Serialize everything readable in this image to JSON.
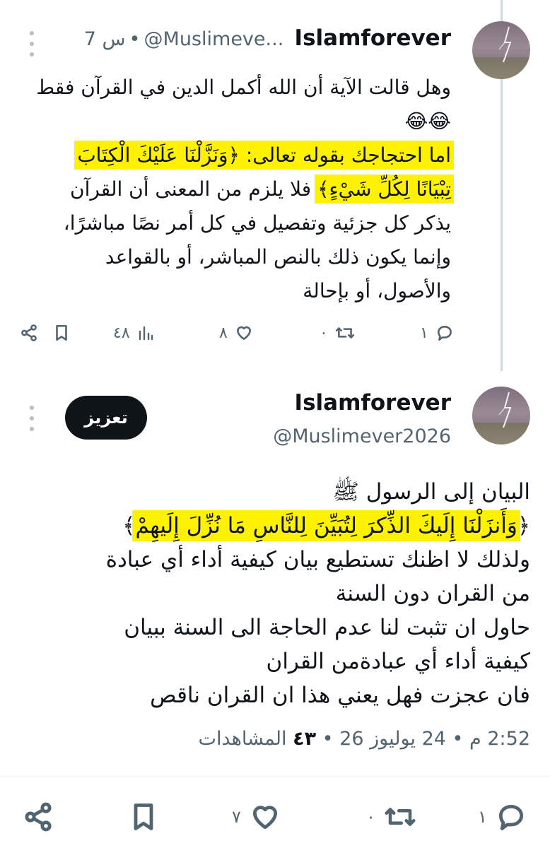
{
  "tweet1": {
    "name": "Islamforever",
    "handle": "@Muslimeve...",
    "sep": "•",
    "time": "7 س",
    "lines": [
      "وهل قالت الآية أن الله أكمل الدين في القرآن فقط"
    ],
    "emoji": "😂😂",
    "highlight_a": "اما احتجاجك بقوله تعالى: ﴿وَنَزَّلْنَا عَلَيْكَ الْكِتَابَ",
    "highlight_b": "تِبْيَانًا لِكُلِّ شَيْءٍ﴾",
    "rest_line": "فلا يلزم من المعنى أن القرآن",
    "more_lines": [
      "يذكر كل جزئية وتفصيل في كل أمر نصًا مباشرًا،",
      "وإنما يكون ذلك بالنص المباشر، أو بالقواعد",
      "والأصول، أو بإحالة"
    ],
    "actions": {
      "reply_count": "١",
      "repost_count": "٠",
      "like_count": "٨",
      "views_count": "٤٨"
    }
  },
  "tweet2": {
    "name": "Islamforever",
    "handle": "@Muslimever2026",
    "boost_label": "تعزيز",
    "line1": "البيان إلى الرسول ﷺ",
    "verse_open": "﴿",
    "verse": "وَأَنزَلْنَا إِلَيكَ الذِّكرَ لِتُبَيِّنَ لِلنَّاسِ مَا نُزِّلَ إِلَيهِمْ",
    "verse_close": "﴾",
    "lines": [
      "ولذلك لا اظنك تستطيع بيان كيفية أداء أي عبادة",
      "من القران دون السنة",
      "حاول ان تثبت لنا عدم الحاجة الى السنة ببيان",
      "كيفية أداء أي عبادةمن القران",
      "فان عجزت فهل يعني هذا ان القران ناقص"
    ],
    "time": "2:52 م",
    "date": "24 يوليوز 26",
    "views_count": "٤٣",
    "views_label": "المشاهدات",
    "sep": "•",
    "actions": {
      "reply_count": "١",
      "repost_count": "٠",
      "like_count": "٧"
    }
  }
}
